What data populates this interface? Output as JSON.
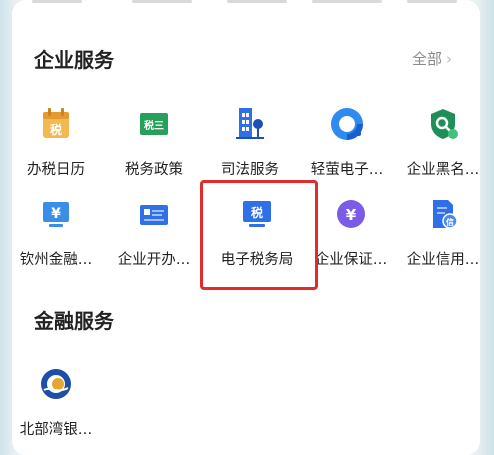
{
  "enterprise_services": {
    "title": "企业服务",
    "all_label": "全部",
    "chevron": "›",
    "items": [
      {
        "label": "办税日历",
        "icon": "calendar-tax-icon",
        "glyph": "税"
      },
      {
        "label": "税务政策",
        "icon": "tax-policy-icon",
        "glyph": "税三"
      },
      {
        "label": "司法服务",
        "icon": "justice-building-icon"
      },
      {
        "label": "轻萤电子…",
        "icon": "qingying-logo-icon"
      },
      {
        "label": "企业黑名…",
        "icon": "shield-search-icon"
      },
      {
        "label": "钦州金融…",
        "icon": "finance-monitor-icon",
        "glyph": "¥"
      },
      {
        "label": "企业开办…",
        "icon": "business-register-icon"
      },
      {
        "label": "电子税务局",
        "icon": "e-tax-bureau-icon",
        "glyph": "税"
      },
      {
        "label": "企业保证…",
        "icon": "yen-circle-icon",
        "glyph": "¥"
      },
      {
        "label": "企业信用…",
        "icon": "credit-document-icon",
        "glyph": "信"
      }
    ]
  },
  "finance_services": {
    "title": "金融服务",
    "items": [
      {
        "label": "北部湾银…",
        "icon": "beibu-gulf-bank-logo-icon"
      }
    ]
  },
  "colors": {
    "orange": "#e9a13b",
    "green": "#26a05a",
    "blue": "#2f6fe8",
    "purple": "#7b5ce6",
    "highlight": "#e02c2c"
  }
}
